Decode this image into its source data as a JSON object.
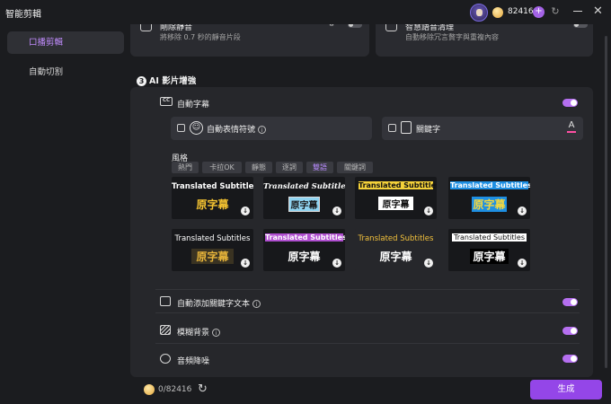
{
  "app": {
    "title": "智能剪輯"
  },
  "account": {
    "credits": "82416",
    "plus": "+"
  },
  "sidebar": {
    "items": [
      {
        "label": "口播剪輯"
      },
      {
        "label": "自動切割"
      }
    ]
  },
  "top_cards": [
    {
      "title": "剛除靜音",
      "desc": "將移除 0.7 秒的靜音片段"
    },
    {
      "title": "智慧語音清理",
      "desc": "自動移除冗言贅字與重複內容"
    }
  ],
  "section": {
    "number": "3",
    "title": "AI 影片增強"
  },
  "subtitles": {
    "label": "自動字幕",
    "emoji_option": "自動表情符號",
    "keyword_option": "關鍵字",
    "style_label": "風格",
    "tabs": [
      "熱門",
      "卡拉OK",
      "靜態",
      "逐詞",
      "雙語",
      "關鍵詞"
    ],
    "active_tab": "雙語",
    "tiles": [
      {
        "en": "Translated Subtitles",
        "cn": "原字幕"
      },
      {
        "en": "Translated Subtitles",
        "cn": "原字幕"
      },
      {
        "en": "Translated Subtitles",
        "cn": "原字幕"
      },
      {
        "en": "Translated Subtitles",
        "cn": "原字幕"
      },
      {
        "en": "Translated Subtitles",
        "cn": "原字幕"
      },
      {
        "en": "Translated Subtitles",
        "cn": "原字幕"
      },
      {
        "en": "Translated Subtitles",
        "cn": "原字幕"
      },
      {
        "en": "Translated Subtitles",
        "cn": "原字幕"
      }
    ]
  },
  "options": [
    {
      "label": "自動添加關鍵字文本",
      "icon": "sparkle-text-icon",
      "on": true
    },
    {
      "label": "模糊背景",
      "icon": "blur-icon",
      "on": true
    },
    {
      "label": "音頻降噪",
      "icon": "audio-denoise-icon",
      "on": true
    }
  ],
  "footer": {
    "credits_used": "0/82416",
    "generate_label": "生成"
  },
  "colors": {
    "accent": "#9446e8",
    "toggle_on": "#b56ff0",
    "active_text": "#c28dff"
  }
}
